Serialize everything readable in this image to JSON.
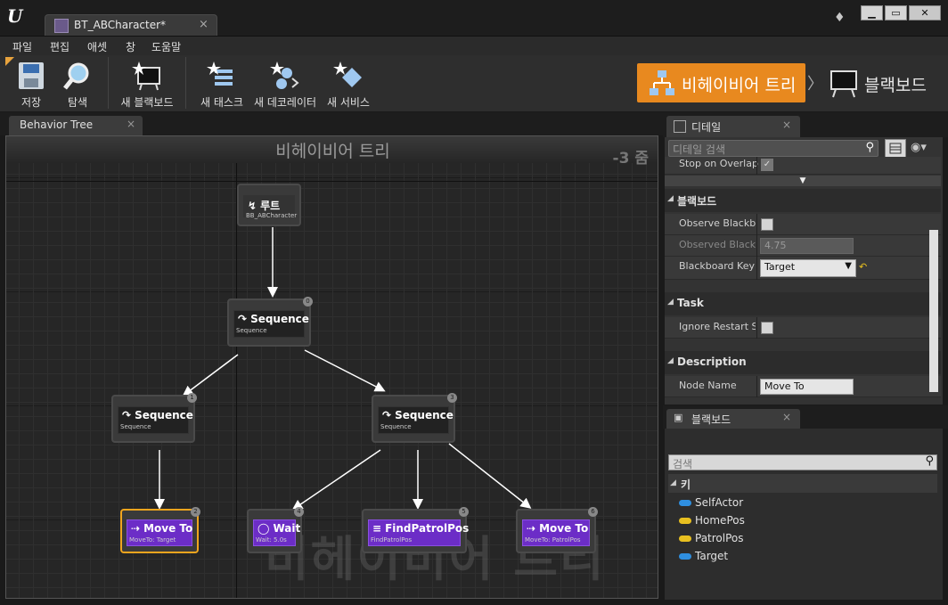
{
  "window": {
    "tab_title": "BT_ABCharacter*",
    "tab_close": "×",
    "min": "▁",
    "max": "▭",
    "close": "✕"
  },
  "menu": [
    "파일",
    "편집",
    "애셋",
    "창",
    "도움말"
  ],
  "toolbar": {
    "save": "저장",
    "browse": "탐색",
    "new_blackboard": "새 블랙보드",
    "new_task": "새 태스크",
    "new_decorator": "새 데코레이터",
    "new_service": "새 서비스",
    "mode_behavior_tree": "비헤이비어 트리",
    "mode_chevron": "〉",
    "mode_blackboard": "블랙보드",
    "accent_color": "#e8891f"
  },
  "graph": {
    "tab_label": "Behavior Tree",
    "tab_close": "×",
    "title": "비헤이비어 트리",
    "zoom": "-3 줌",
    "watermark": "비헤이비어 트리",
    "nodes": {
      "root": {
        "title": "루트",
        "sub": "BB_ABCharacter"
      },
      "seq0": {
        "title": "Sequence",
        "sub": "Sequence",
        "index": "0"
      },
      "seq1": {
        "title": "Sequence",
        "sub": "Sequence",
        "index": "1"
      },
      "seq3": {
        "title": "Sequence",
        "sub": "Sequence",
        "index": "3"
      },
      "move2": {
        "title": "Move To",
        "sub": "MoveTo: Target",
        "index": "2"
      },
      "wait4": {
        "title": "Wait",
        "sub": "Wait: 5.0s",
        "index": "4"
      },
      "find5": {
        "title": "FindPatrolPos",
        "sub": "FindPatrolPos",
        "index": "5"
      },
      "move6": {
        "title": "Move To",
        "sub": "MoveTo: PatrolPos",
        "index": "6"
      }
    }
  },
  "details": {
    "tab_label": "디테일",
    "tab_close": "×",
    "search_placeholder": "디테일 검색",
    "stop_on_overlap": "Stop on Overlap",
    "cat_blackboard": "블랙보드",
    "observe_blackboard": "Observe Blackboard Value",
    "observed_blackboard": "Observed Blackboard Value Tolerance",
    "observed_value": "4.75",
    "blackboard_key": "Blackboard Key",
    "blackboard_key_value": "Target",
    "cat_task": "Task",
    "ignore_restart": "Ignore Restart Self",
    "cat_description": "Description",
    "node_name": "Node Name",
    "node_name_value": "Move To"
  },
  "blackboard": {
    "tab_label": "블랙보드",
    "tab_close": "×",
    "search_placeholder": "검색",
    "category": "키",
    "keys": [
      {
        "name": "SelfActor",
        "color": "#2f8fe0"
      },
      {
        "name": "HomePos",
        "color": "#e8c020"
      },
      {
        "name": "PatrolPos",
        "color": "#e8c020"
      },
      {
        "name": "Target",
        "color": "#2f8fe0"
      }
    ]
  }
}
